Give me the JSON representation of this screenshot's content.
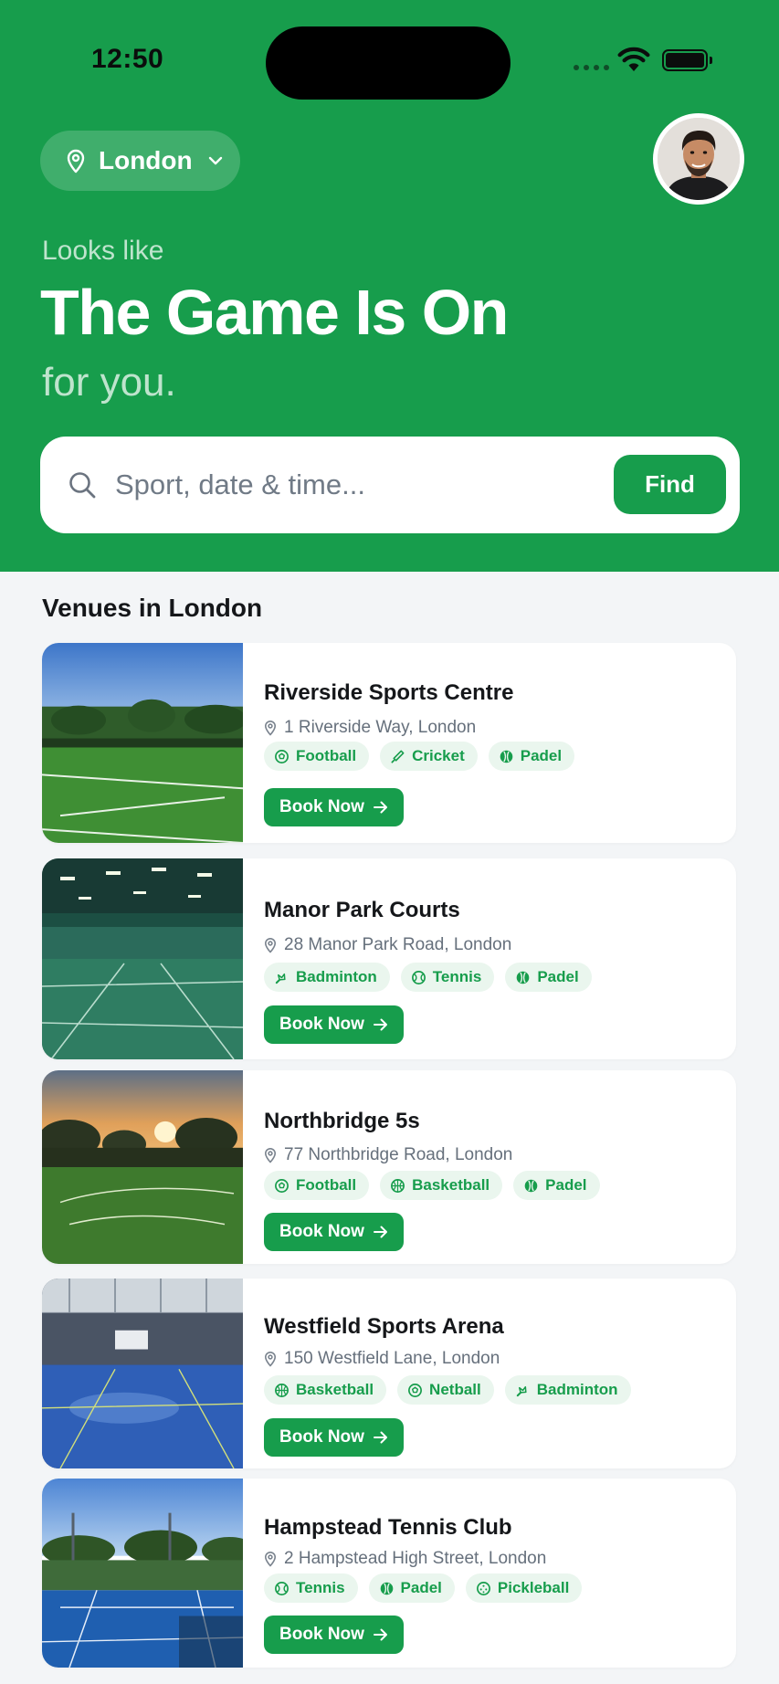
{
  "status_bar": {
    "time": "12:50"
  },
  "header": {
    "location": "London",
    "kicker": "Looks like",
    "title": "The Game Is On",
    "subtitle": "for you."
  },
  "search": {
    "placeholder": "Sport, date & time...",
    "value": "",
    "button_label": "Find"
  },
  "venues_section": {
    "title": "Venues in London",
    "book_label": "Book Now",
    "items": [
      {
        "name": "Riverside Sports Centre",
        "address": "1 Riverside Way, London",
        "tags": [
          {
            "label": "Football",
            "icon": "football-icon"
          },
          {
            "label": "Cricket",
            "icon": "cricket-icon"
          },
          {
            "label": "Padel",
            "icon": "padel-icon"
          }
        ],
        "image": "outdoor-pitch-daytime"
      },
      {
        "name": "Manor Park Courts",
        "address": "28 Manor Park Road, London",
        "tags": [
          {
            "label": "Badminton",
            "icon": "badminton-icon"
          },
          {
            "label": "Tennis",
            "icon": "tennis-icon"
          },
          {
            "label": "Padel",
            "icon": "padel-icon"
          }
        ],
        "image": "indoor-court-green"
      },
      {
        "name": "Northbridge 5s",
        "address": "77 Northbridge Road, London",
        "tags": [
          {
            "label": "Football",
            "icon": "football-icon"
          },
          {
            "label": "Basketball",
            "icon": "basketball-icon"
          },
          {
            "label": "Padel",
            "icon": "padel-icon"
          }
        ],
        "image": "outdoor-pitch-sunset"
      },
      {
        "name": "Westfield Sports Arena",
        "address": "150 Westfield Lane, London",
        "tags": [
          {
            "label": "Basketball",
            "icon": "basketball-icon"
          },
          {
            "label": "Netball",
            "icon": "netball-icon"
          },
          {
            "label": "Badminton",
            "icon": "badminton-icon"
          }
        ],
        "image": "indoor-court-blue"
      },
      {
        "name": "Hampstead Tennis Club",
        "address": "2 Hampstead High Street, London",
        "tags": [
          {
            "label": "Tennis",
            "icon": "tennis-icon"
          },
          {
            "label": "Padel",
            "icon": "padel-icon"
          },
          {
            "label": "Pickleball",
            "icon": "pickleball-icon"
          }
        ],
        "image": "outdoor-tennis-courts"
      }
    ]
  },
  "colors": {
    "brand_green": "#179d4c",
    "tag_bg": "#eaf6ee",
    "page_bg": "#f3f5f7"
  }
}
